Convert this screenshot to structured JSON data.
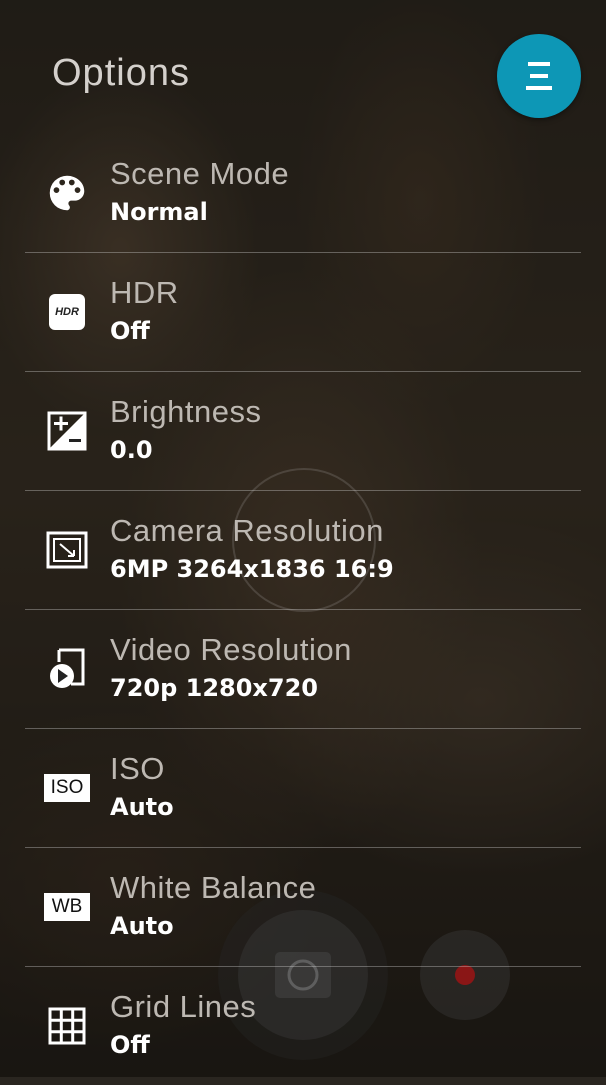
{
  "header": {
    "title": "Options",
    "menu_icon": "menu-icon",
    "accent_color": "#0d97b6"
  },
  "options": [
    {
      "icon": "palette-icon",
      "label": "Scene Mode",
      "value": "Normal"
    },
    {
      "icon": "hdr-icon",
      "label": "HDR",
      "value": "Off",
      "icon_text": "HDR"
    },
    {
      "icon": "exposure-icon",
      "label": "Brightness",
      "value": "0.0"
    },
    {
      "icon": "photo-size-icon",
      "label": "Camera Resolution",
      "value": "6MP 3264x1836 16:9"
    },
    {
      "icon": "video-file-icon",
      "label": "Video Resolution",
      "value": "720p 1280x720"
    },
    {
      "icon": "iso-icon",
      "label": "ISO",
      "value": "Auto",
      "icon_text": "ISO"
    },
    {
      "icon": "white-balance-icon",
      "label": "White Balance",
      "value": "Auto",
      "icon_text": "WB"
    },
    {
      "icon": "grid-icon",
      "label": "Grid Lines",
      "value": "Off"
    }
  ],
  "camera_controls": {
    "shutter_icon": "camera-icon",
    "record_icon": "record-icon",
    "record_color": "#8a1616"
  }
}
